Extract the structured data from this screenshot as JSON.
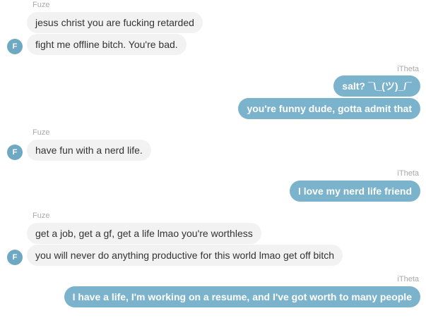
{
  "colors": {
    "incoming_bubble": "#f2f2f2",
    "outgoing_bubble": "#7ab3cb",
    "avatar": "#6ea8c2",
    "sender_name": "#a8a8a8"
  },
  "messages": {
    "group1": {
      "sender": "Fuze",
      "avatar_letter": "F",
      "lines": [
        "jesus christ you are fucking retarded",
        "fight me offline bitch. You're bad."
      ]
    },
    "group2": {
      "sender": "iTheta",
      "lines": [
        "salt? ¯\\_(ツ)_/¯",
        "you're funny dude, gotta admit that"
      ]
    },
    "group3": {
      "sender": "Fuze",
      "avatar_letter": "F",
      "lines": [
        "have fun with a nerd life."
      ]
    },
    "group4": {
      "sender": "iTheta",
      "lines": [
        "I love my nerd life friend"
      ]
    },
    "group5": {
      "sender": "Fuze",
      "avatar_letter": "F",
      "lines": [
        "get a job, get a gf, get a life lmao you're worthless",
        "you will never do anything productive for this world lmao get off bitch"
      ]
    },
    "group6": {
      "sender": "iTheta",
      "lines": [
        "I have a life, I'm working on a resume, and I've got worth to many people"
      ]
    }
  }
}
